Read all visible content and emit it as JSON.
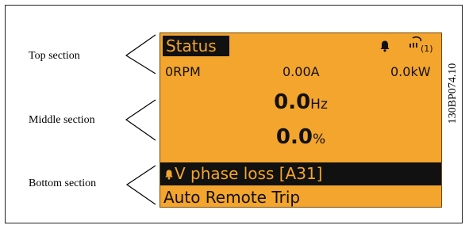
{
  "labels": {
    "top": "Top section",
    "middle": "Middle section",
    "bottom": "Bottom section"
  },
  "figure_code": "130BP074.10",
  "display": {
    "status_title": "Status",
    "icons": [
      "bell-icon",
      "hand-icon"
    ],
    "hand_badge": "(1)",
    "rpm": "0RPM",
    "current": "0.00A",
    "power": "0.0kW",
    "frequency_value": "0.0",
    "frequency_unit": "Hz",
    "percent_value": "0.0",
    "percent_unit": "%",
    "alarm_text": "V phase loss [A31]",
    "mode_text": "Auto Remote Trip"
  },
  "colors": {
    "display_background": "#f4a52d",
    "inverse_text_background": "#111111"
  }
}
